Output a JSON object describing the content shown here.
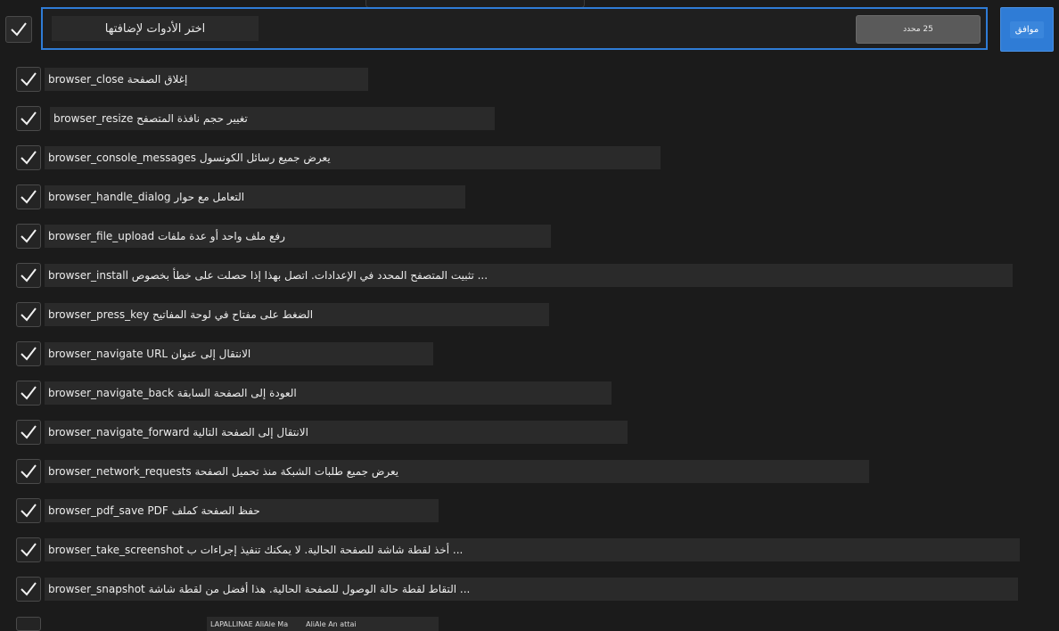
{
  "header": {
    "title": "اختر الأدوات لإضافتها",
    "selected_count": "25 محدد",
    "ok_label": "موافق"
  },
  "tools": [
    {
      "text": "إغلاق الصفحة browser_close"
    },
    {
      "text": "تغيير حجم نافذة المتصفح browser_resize"
    },
    {
      "text": "يعرض جميع رسائل الكونسول browser_console_messages"
    },
    {
      "text": "التعامل مع حوار browser_handle_dialog"
    },
    {
      "text": "رفع ملف واحد أو عدة ملفات browser_file_upload"
    },
    {
      "text": "... تثبيت المتصفح المحدد في الإعدادات. اتصل بهذا إذا حصلت على خطأ بخصوص browser_install"
    },
    {
      "text": "الضغط على مفتاح في لوحة المفاتيح browser_press_key"
    },
    {
      "text": "الانتقال إلى عنوان browser_navigate URL"
    },
    {
      "text": "العودة إلى الصفحة السابقة browser_navigate_back"
    },
    {
      "text": "الانتقال إلى الصفحة التالية browser_navigate_forward"
    },
    {
      "text": "يعرض جميع طلبات الشبكة منذ تحميل الصفحة browser_network_requests"
    },
    {
      "text": "حفظ الصفحة كملف browser_pdf_save PDF"
    },
    {
      "text": "... أخذ لقطة شاشة للصفحة الحالية. لا يمكنك تنفيذ إجراءات ب browser_take_screenshot"
    },
    {
      "text": "... التقاط لقطة حالة الوصول للصفحة الحالية. هذا أفضل من لقطة شاشة browser_snapshot"
    }
  ],
  "footer": {
    "partial_label": "LAPALLINAE AliAle Ma",
    "partial_label_2": "AliAle An attai"
  },
  "icons": {
    "check": "checkmark-icon"
  },
  "colors": {
    "accent": "#2f7cd6",
    "background": "#1b1b1b"
  }
}
